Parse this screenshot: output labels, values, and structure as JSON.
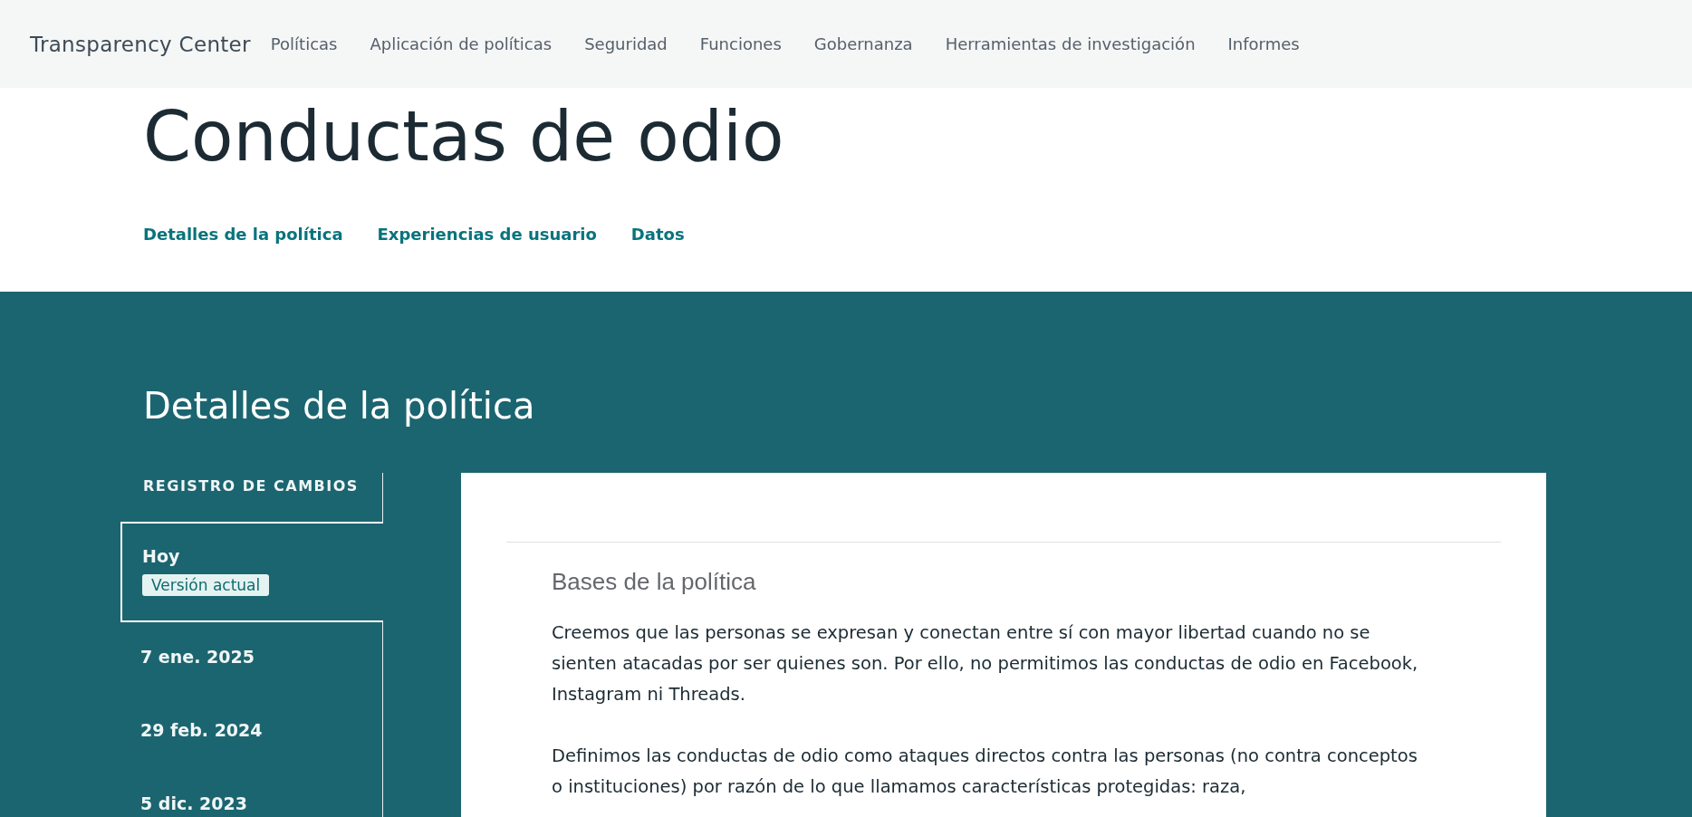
{
  "header": {
    "brand": "Transparency Center",
    "nav": [
      "Políticas",
      "Aplicación de políticas",
      "Seguridad",
      "Funciones",
      "Gobernanza",
      "Herramientas de investigación",
      "Informes"
    ]
  },
  "page_title": "Conductas de odio",
  "sub_tabs": [
    "Detalles de la política",
    "Experiencias de usuario",
    "Datos"
  ],
  "section_title": "Detalles de la política",
  "changelog": {
    "heading": "REGISTRO DE CAMBIOS",
    "items": [
      {
        "date": "Hoy",
        "badge": "Versión actual",
        "selected": true
      },
      {
        "date": "7 ene. 2025",
        "selected": false
      },
      {
        "date": "29 feb. 2024",
        "selected": false
      },
      {
        "date": "5 dic. 2023",
        "selected": false
      }
    ]
  },
  "content": {
    "heading": "Bases de la política",
    "paragraphs": [
      "Creemos que las personas se expresan y conectan entre sí con mayor libertad cuando no se sienten atacadas por ser quienes son. Por ello, no permitimos las conductas de odio en Facebook, Instagram ni Threads.",
      "Definimos las conductas de odio como ataques directos contra las personas (no contra conceptos o instituciones) por razón de lo que llamamos características protegidas: raza,"
    ]
  }
}
